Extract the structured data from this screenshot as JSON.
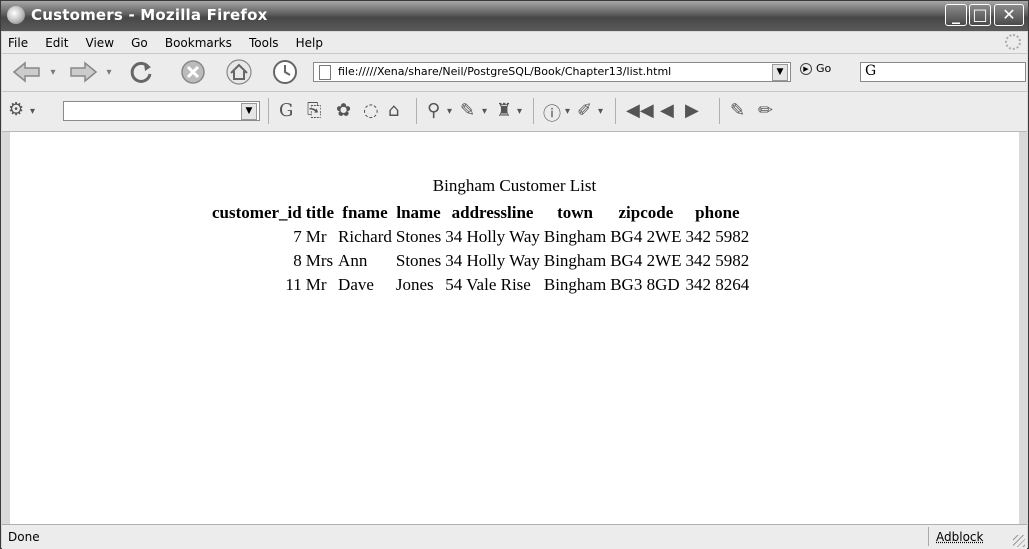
{
  "window": {
    "title": "Customers - Mozilla Firefox",
    "buttons": {
      "minimize": "_",
      "maximize": "□",
      "close": "✕"
    }
  },
  "menubar": {
    "items": [
      "File",
      "Edit",
      "View",
      "Go",
      "Bookmarks",
      "Tools",
      "Help"
    ]
  },
  "navbar": {
    "back_icon": "back-arrow-icon",
    "forward_icon": "forward-arrow-icon",
    "reload_icon": "reload-icon",
    "stop_icon": "stop-icon",
    "home_icon": "home-icon",
    "history_icon": "clock-icon",
    "url": "file://///Xena/share/Neil/PostgreSQL/Book/Chapter13/list.html",
    "go_label": "Go",
    "search_icon": "google-g-icon"
  },
  "google_toolbar": {
    "search_value": ""
  },
  "page": {
    "heading": "Bingham Customer List",
    "columns": [
      "customer_id",
      "title",
      "fname",
      "lname",
      "addressline",
      "town",
      "zipcode",
      "phone"
    ],
    "rows": [
      [
        "7",
        "Mr",
        "Richard",
        "Stones",
        "34 Holly Way",
        "Bingham",
        "BG4 2WE",
        "342 5982"
      ],
      [
        "8",
        "Mrs",
        "Ann",
        "Stones",
        "34 Holly Way",
        "Bingham",
        "BG4 2WE",
        "342 5982"
      ],
      [
        "11",
        "Mr",
        "Dave",
        "Jones",
        "54 Vale Rise",
        "Bingham",
        "BG3 8GD",
        "342 8264"
      ]
    ]
  },
  "statusbar": {
    "status": "Done",
    "adblock": "Adblock"
  }
}
